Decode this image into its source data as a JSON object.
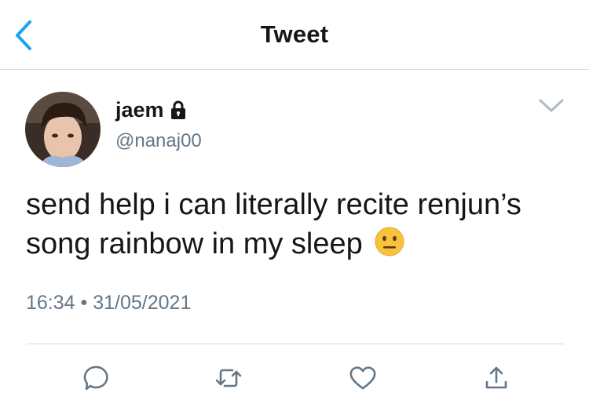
{
  "header": {
    "title": "Tweet",
    "back_icon": "chevron-left-icon",
    "accent": "#1da1f2"
  },
  "tweet": {
    "display_name": "jaem",
    "handle": "@nanaj00",
    "text": "send help i can literally recite renjun’s song rainbow in my sleep",
    "emoji": "neutral-face-emoji",
    "time": "16:34",
    "separator": "•",
    "date": "31/05/2021"
  },
  "actions": [
    "reply-icon",
    "retweet-icon",
    "like-icon",
    "share-icon"
  ],
  "colors": {
    "text": "#14171a",
    "secondary": "#657786",
    "divider": "#d5d9dd"
  }
}
